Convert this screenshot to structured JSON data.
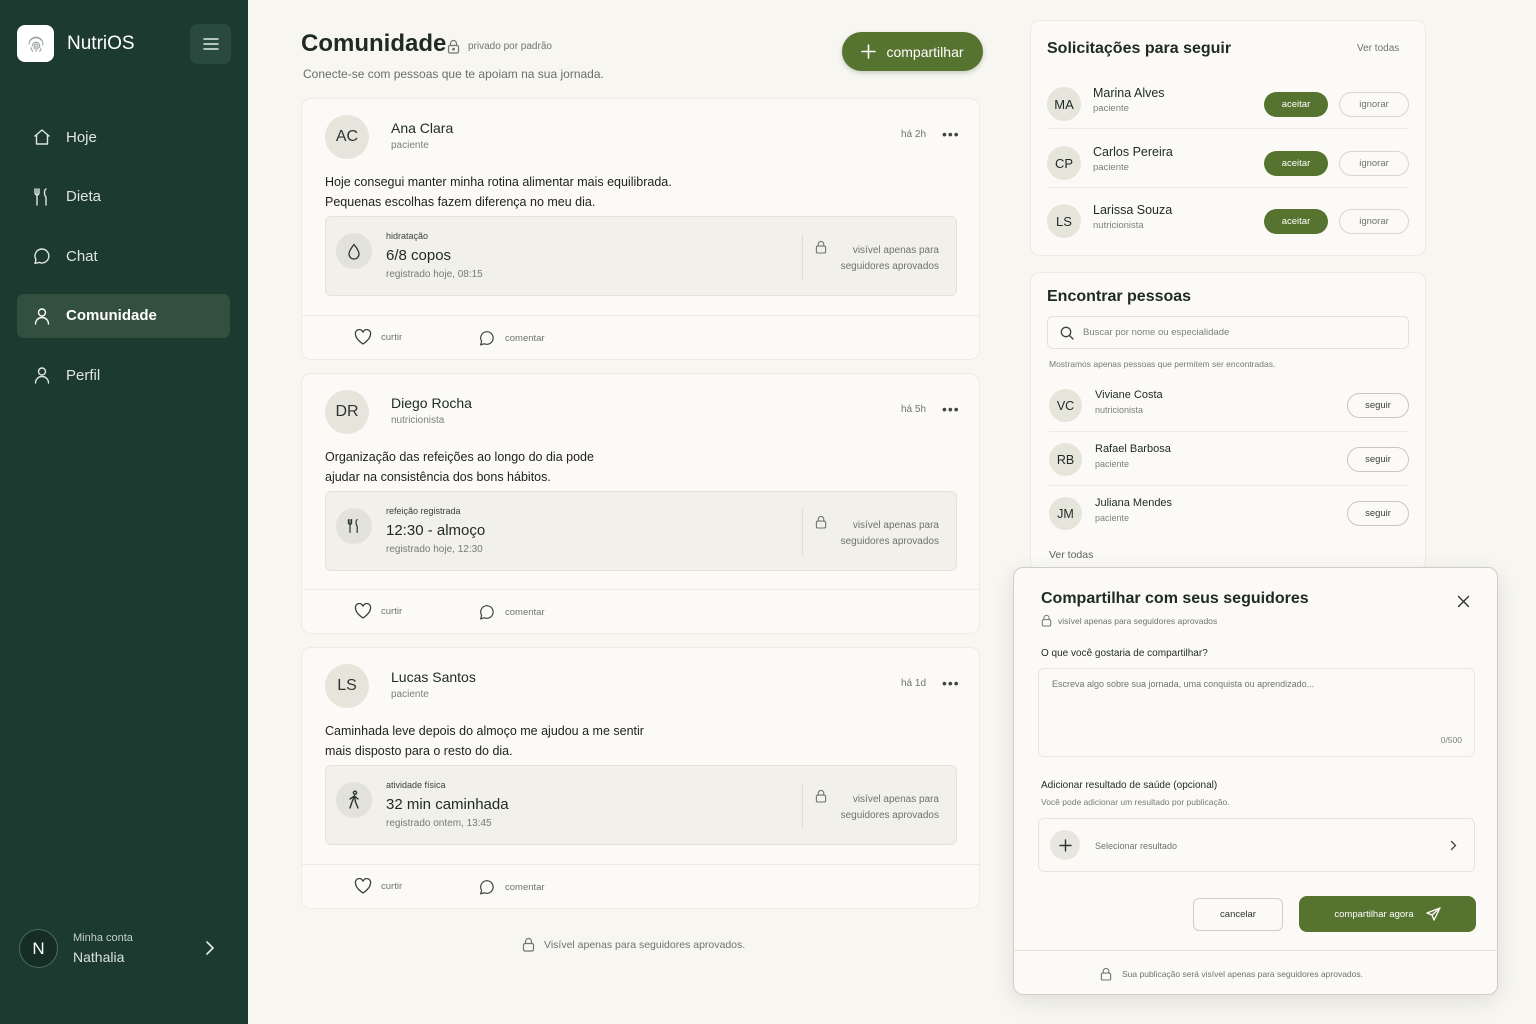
{
  "app": {
    "name": "NutriOS"
  },
  "sidebar": {
    "items": [
      {
        "label": "Hoje",
        "icon": "home-icon"
      },
      {
        "label": "Dieta",
        "icon": "utensils-icon"
      },
      {
        "label": "Chat",
        "icon": "chat-bubble-icon"
      },
      {
        "label": "Comunidade",
        "icon": "person-icon",
        "active": true
      },
      {
        "label": "Perfil",
        "icon": "person-icon"
      }
    ],
    "account": {
      "avatar_letter": "N",
      "label": "Minha conta",
      "name": "Nathalia"
    }
  },
  "header": {
    "title": "Comunidade",
    "privacy": "privado por padrão",
    "subtitle": "Conecte-se com pessoas que te apoiam na sua jornada.",
    "share_label": "compartilhar"
  },
  "posts": [
    {
      "initials": "AC",
      "name": "Ana Clara",
      "role": "paciente",
      "time": "há 2h",
      "text": [
        "Hoje consegui manter minha rotina alimentar mais equilibrada.",
        "Pequenas escolhas fazem diferença no meu dia."
      ],
      "card": {
        "icon": "water-drop-icon",
        "label": "hidratação",
        "value": "6/8 copos",
        "when": "registrado hoje, 08:15",
        "visibility": "visível apenas para seguidores aprovados"
      },
      "like": "curtir",
      "comment": "comentar"
    },
    {
      "initials": "DR",
      "name": "Diego Rocha",
      "role": "nutricionista",
      "time": "há 5h",
      "text": [
        "Organização das refeições ao longo do dia pode",
        "ajudar na consistência dos bons hábitos."
      ],
      "card": {
        "icon": "utensils-icon",
        "label": "refeição registrada",
        "value": "12:30 - almoço",
        "when": "registrado hoje, 12:30",
        "visibility": "visível apenas para seguidores aprovados"
      },
      "like": "curtir",
      "comment": "comentar"
    },
    {
      "initials": "LS",
      "name": "Lucas Santos",
      "role": "paciente",
      "time": "há 1d",
      "text": [
        "Caminhada leve depois do almoço me ajudou a me sentir",
        "mais disposto para o resto do dia."
      ],
      "card": {
        "icon": "walking-icon",
        "label": "atividade física",
        "value": "32 min caminhada",
        "when": "registrado ontem, 13:45",
        "visibility": "visível apenas para seguidores aprovados"
      },
      "like": "curtir",
      "comment": "comentar"
    }
  ],
  "feed_note": "Visível apenas para seguidores aprovados.",
  "requests": {
    "title": "Solicitações para seguir",
    "see_all": "Ver todas",
    "accept_label": "aceitar",
    "ignore_label": "ignorar",
    "items": [
      {
        "initials": "MA",
        "name": "Marina Alves",
        "role": "paciente"
      },
      {
        "initials": "CP",
        "name": "Carlos Pereira",
        "role": "paciente"
      },
      {
        "initials": "LS",
        "name": "Larissa Souza",
        "role": "nutricionista"
      }
    ]
  },
  "find": {
    "title": "Encontrar pessoas",
    "search_placeholder": "Buscar por nome ou especialidade",
    "note": "Mostramos apenas pessoas que permitem ser encontradas.",
    "follow_label": "seguir",
    "see_all": "Ver todas",
    "items": [
      {
        "initials": "VC",
        "name": "Viviane Costa",
        "role": "nutricionista"
      },
      {
        "initials": "RB",
        "name": "Rafael Barbosa",
        "role": "paciente"
      },
      {
        "initials": "JM",
        "name": "Juliana Mendes",
        "role": "paciente"
      }
    ]
  },
  "modal": {
    "title": "Compartilhar com seus seguidores",
    "subtitle": "visível apenas para seguidores aprovados",
    "question": "O que você gostaria de compartilhar?",
    "placeholder": "Escreva algo sobre sua jornada, uma conquista ou aprendizado...",
    "char_count": "0/500",
    "add_title": "Adicionar resultado de saúde (opcional)",
    "add_sub": "Você pode adicionar um resultado por publicação.",
    "select_label": "Selecionar resultado",
    "cancel_label": "cancelar",
    "submit_label": "compartilhar agora",
    "footer": "Sua publicação será visível apenas para seguidores aprovados."
  },
  "colors": {
    "sidebar": "#1d3a30",
    "accent": "#56732f",
    "background": "#f7f6f1"
  }
}
